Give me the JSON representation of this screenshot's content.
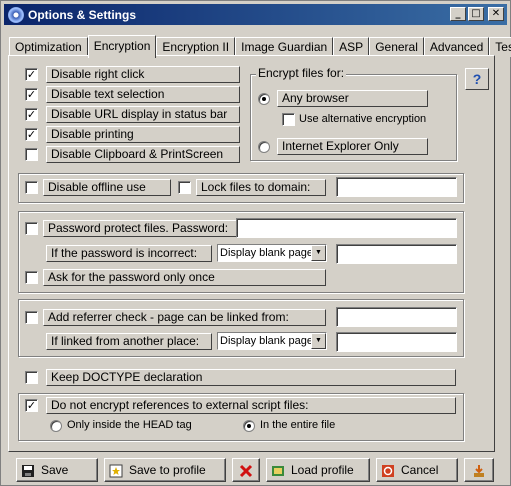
{
  "window": {
    "title": "Options & Settings",
    "min_glyph": "_",
    "max_glyph": "□",
    "close_glyph": "✕"
  },
  "tabs": [
    {
      "label": "Optimization"
    },
    {
      "label": "Encryption",
      "active": true
    },
    {
      "label": "Encryption II"
    },
    {
      "label": "Image Guardian"
    },
    {
      "label": "ASP"
    },
    {
      "label": "General"
    },
    {
      "label": "Advanced"
    },
    {
      "label": "Test"
    }
  ],
  "disable_options": [
    {
      "label": "Disable right click",
      "checked": true
    },
    {
      "label": "Disable text selection",
      "checked": true
    },
    {
      "label": "Disable URL display in status bar",
      "checked": true
    },
    {
      "label": "Disable printing",
      "checked": true
    },
    {
      "label": "Disable Clipboard & PrintScreen",
      "checked": false
    }
  ],
  "encrypt_for": {
    "legend": "Encrypt files for:",
    "any_browser": "Any browser",
    "alt_encryption": "Use alternative encryption",
    "ie_only": "Internet Explorer Only",
    "selected": "Any browser"
  },
  "offline": {
    "disable_offline": "Disable offline use",
    "lock_domain": "Lock files to domain:",
    "domain_value": ""
  },
  "password": {
    "protect_label": "Password protect files.  Password:",
    "incorrect_label": "If the password is incorrect:",
    "incorrect_select": "Display blank page",
    "ask_once": "Ask for the password only once"
  },
  "referrer": {
    "check_label": "Add referrer check - page can be linked from:",
    "linked_label": "If linked from another place:",
    "linked_select": "Display blank page"
  },
  "doctype": {
    "label": "Keep DOCTYPE declaration"
  },
  "scripts": {
    "label": "Do not encrypt references to external script files:",
    "head_only": "Only inside the HEAD tag",
    "entire_file": "In the entire file",
    "selected": "In the entire file"
  },
  "help_glyph": "?",
  "buttons": {
    "save": "Save",
    "save_profile": "Save to profile",
    "load_profile": "Load profile",
    "cancel": "Cancel"
  },
  "icons": {
    "save": "floppy-disk-icon",
    "save_profile": "profile-star-icon",
    "delete": "red-x-icon",
    "load_profile": "load-folder-icon",
    "cancel": "cancel-circle-icon",
    "download": "download-arrow-icon"
  },
  "colors": {
    "titlebar_start": "#0a246a",
    "titlebar_end": "#3a6ea5",
    "face": "#d4d0c8"
  }
}
